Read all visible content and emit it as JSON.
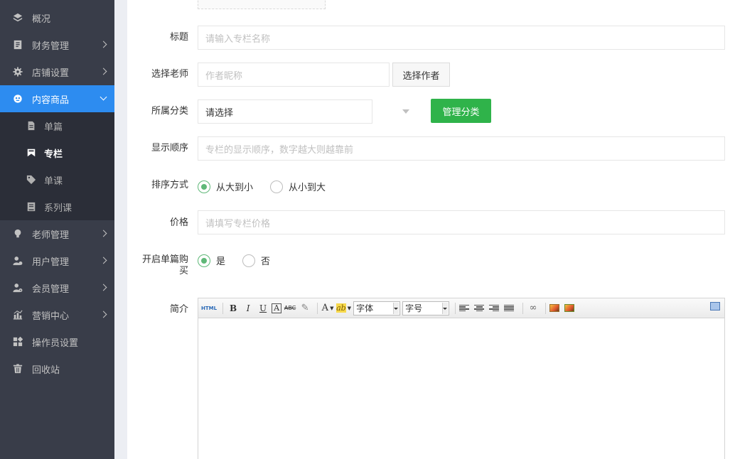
{
  "sidebar": {
    "items": [
      {
        "label": "概况",
        "icon": "layers-icon"
      },
      {
        "label": "财务管理",
        "icon": "ledger-icon"
      },
      {
        "label": "店铺设置",
        "icon": "gear-icon"
      },
      {
        "label": "内容商品",
        "icon": "content-icon"
      },
      {
        "label": "老师管理",
        "icon": "lightbulb-icon"
      },
      {
        "label": "用户管理",
        "icon": "user-icon"
      },
      {
        "label": "会员管理",
        "icon": "member-icon"
      },
      {
        "label": "营销中心",
        "icon": "chart-icon"
      },
      {
        "label": "操作员设置",
        "icon": "operator-icon"
      },
      {
        "label": "回收站",
        "icon": "trash-icon"
      }
    ],
    "sub_items": [
      {
        "label": "单篇",
        "icon": "document-icon"
      },
      {
        "label": "专栏",
        "icon": "bookmark-icon"
      },
      {
        "label": "单课",
        "icon": "tag-icon"
      },
      {
        "label": "系列课",
        "icon": "book-icon"
      }
    ],
    "active_color": "#2d8cf0",
    "bg_color": "#393d49"
  },
  "form": {
    "title": {
      "label": "标题",
      "placeholder": "请输入专栏名称"
    },
    "teacher": {
      "label": "选择老师",
      "placeholder": "作者昵称",
      "button": "选择作者"
    },
    "category": {
      "label": "所属分类",
      "value": "请选择",
      "button": "管理分类"
    },
    "order": {
      "label": "显示顺序",
      "placeholder": "专栏的显示顺序，数字越大则越靠前"
    },
    "sort": {
      "label": "排序方式",
      "options": [
        "从大到小",
        "从小到大"
      ],
      "selected": "从大到小"
    },
    "price": {
      "label": "价格",
      "placeholder": "请填写专栏价格"
    },
    "single_buy": {
      "label_line1": "开启单篇购",
      "label_line2": "买",
      "options": [
        "是",
        "否"
      ],
      "selected": "是"
    },
    "intro": {
      "label": "简介"
    }
  },
  "editor": {
    "html_label": "HTML",
    "bold": "B",
    "italic": "I",
    "underline": "U",
    "font_box": "A",
    "strike": "ABC",
    "font_color": "A",
    "highlight": "ab",
    "font_family": "字体",
    "font_size": "字号"
  },
  "colors": {
    "primary_green": "#2fb34a",
    "radio_green": "#5fb878"
  }
}
